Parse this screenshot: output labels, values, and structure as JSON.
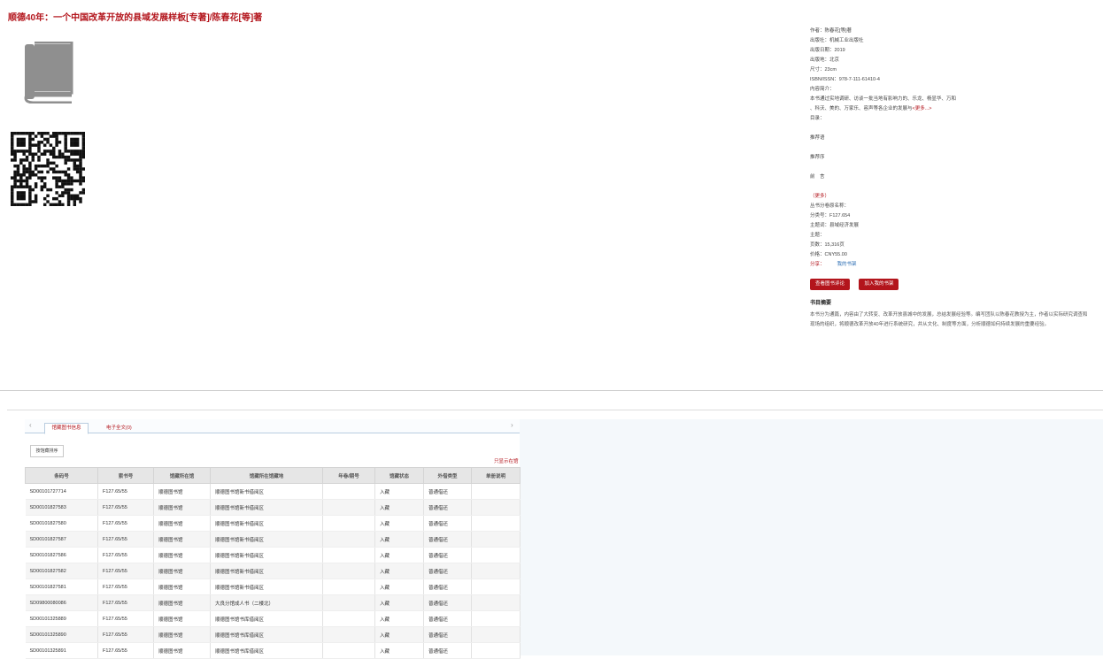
{
  "title": "顺德40年：一个中国改革开放的县域发展样板[专著]/陈春花[等]著",
  "icons": {
    "book": "book-icon",
    "qr": "qr-code"
  },
  "meta": {
    "author": "作者：陈春花[等]著",
    "publisher": "出版社：机械工业出版社",
    "pubdate": "出版日期：2019",
    "place": "出版地：北京",
    "size": "尺寸：23cm",
    "isbn": "ISBN/ISSN：978-7-111-61410-4",
    "intro_label": "内容简介：",
    "intro_line1": "本书通过实地调研、访谈一批当地有影响力的、乐龙、杨显华、万和",
    "intro_line2": "、科沃、美的、万家乐、容声等各企业的发展与",
    "more1": "<更多...>",
    "toc_label": "目录：",
    "toc1": "推荐语",
    "toc2": "推荐序",
    "toc3": "前　言",
    "more2": "（更多）",
    "series": "丛书分卷原名称：",
    "classno": "分类号：F127.654",
    "subject": "主题词：县域经济发展",
    "tags_label": "主题：",
    "pages": "页数：15,316页",
    "price": "价格：CNY55.00",
    "share": "分享：",
    "share_link": "我的书架"
  },
  "buttons": {
    "review": "查看图书评论",
    "shelf": "加入我的书架"
  },
  "summary_title": "书目摘要",
  "summary": "本书分为通篇，内容由了大转变、改革开放县城中的发展，总结发展经验等。编写团队以陈春花教授为主，作者以实际研究调查和现场的组织，将顺德改革开放40年进行系统研究，并从文化、制度等方面，分析顺德如何持续发展的重要经验。",
  "tabs": {
    "tab1": "馆藏图书信息",
    "tab2": "电子全文(0)"
  },
  "sort_label": "按馆藏排序",
  "circ_link": "只显示在馆",
  "table": {
    "headers": [
      "条码号",
      "索书号",
      "馆藏所在馆",
      "馆藏所在馆藏地",
      "年卷/期号",
      "馆藏状态",
      "外借类型",
      "单册说明"
    ],
    "rows": [
      [
        "SD00101727714",
        "F127.65/55",
        "顺德图书馆",
        "顺德图书馆新书借阅区",
        "",
        "入藏",
        "普通借还",
        ""
      ],
      [
        "SD00101827583",
        "F127.65/55",
        "顺德图书馆",
        "顺德图书馆新书借阅区",
        "",
        "入藏",
        "普通借还",
        ""
      ],
      [
        "SD00101827580",
        "F127.65/55",
        "顺德图书馆",
        "顺德图书馆新书借阅区",
        "",
        "入藏",
        "普通借还",
        ""
      ],
      [
        "SD00101827587",
        "F127.65/55",
        "顺德图书馆",
        "顺德图书馆新书借阅区",
        "",
        "入藏",
        "普通借还",
        ""
      ],
      [
        "SD00101827586",
        "F127.65/55",
        "顺德图书馆",
        "顺德图书馆新书借阅区",
        "",
        "入藏",
        "普通借还",
        ""
      ],
      [
        "SD00101827582",
        "F127.65/55",
        "顺德图书馆",
        "顺德图书馆新书借阅区",
        "",
        "入藏",
        "普通借还",
        ""
      ],
      [
        "SD00101827581",
        "F127.65/55",
        "顺德图书馆",
        "顺德图书馆新书借阅区",
        "",
        "入藏",
        "普通借还",
        ""
      ],
      [
        "SD09800080086",
        "F127.65/55",
        "顺德图书馆",
        "大良分馆成人书（二楼北）",
        "",
        "入藏",
        "普通借还",
        ""
      ],
      [
        "SD00101325889",
        "F127.65/55",
        "顺德图书馆",
        "顺德图书馆书库借阅区",
        "",
        "入藏",
        "普通借还",
        ""
      ],
      [
        "SD00101325890",
        "F127.65/55",
        "顺德图书馆",
        "顺德图书馆书库借阅区",
        "",
        "入藏",
        "普通借还",
        ""
      ],
      [
        "SD00101325891",
        "F127.65/55",
        "顺德图书馆",
        "顺德图书馆书库借阅区",
        "",
        "入藏",
        "普通借还",
        ""
      ]
    ]
  }
}
